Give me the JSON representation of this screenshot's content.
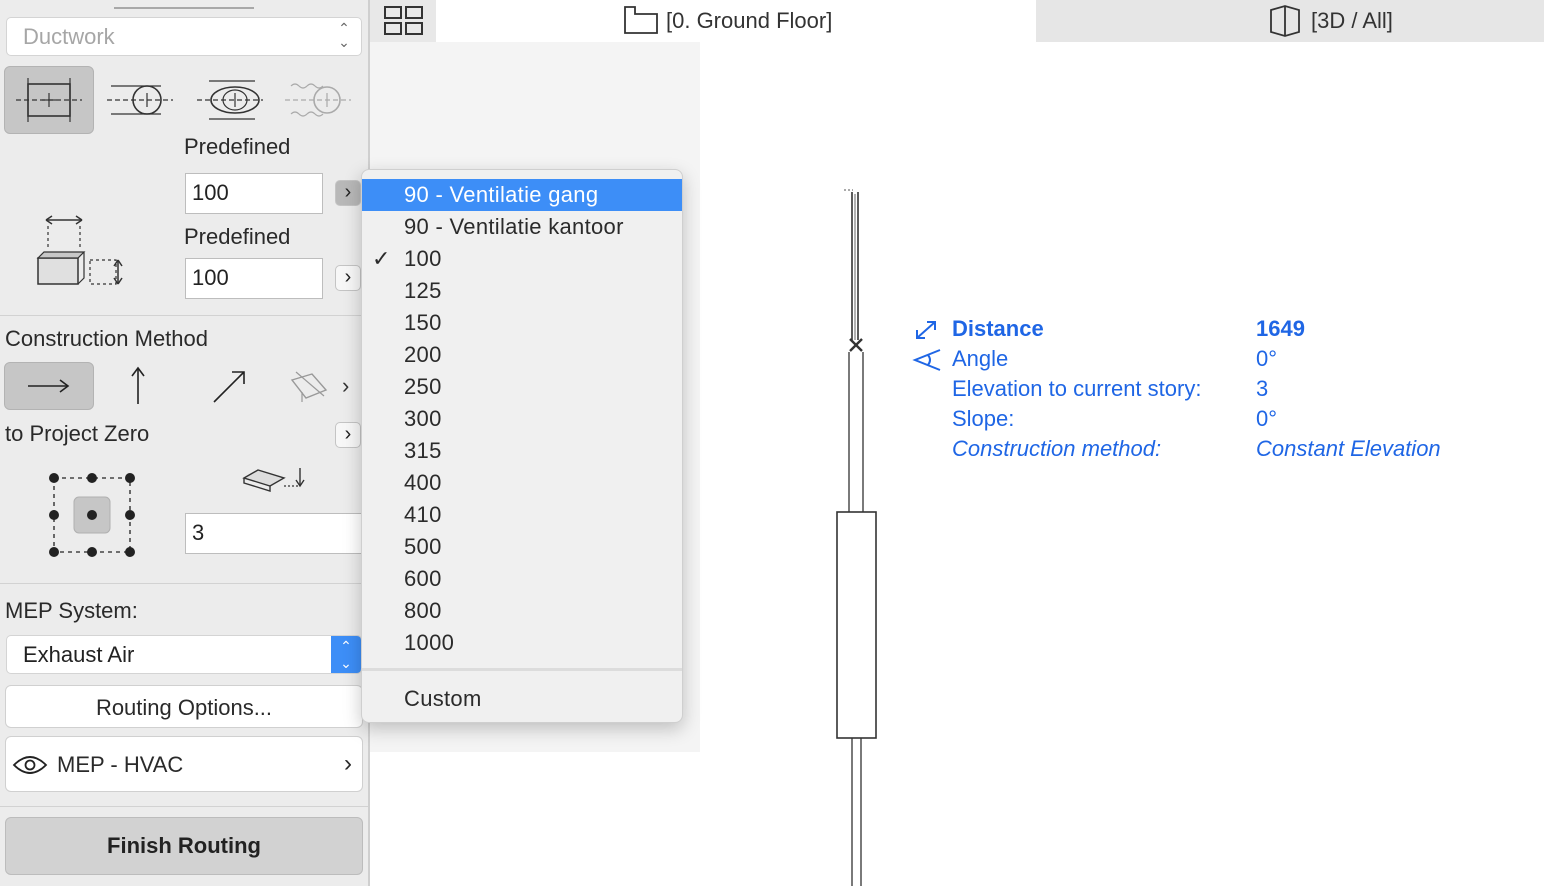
{
  "left_panel": {
    "tool_select": "Ductwork",
    "predefined_label_1": "Predefined",
    "width_value": "100",
    "predefined_label_2": "Predefined",
    "height_value": "100",
    "construction_method_label": "Construction Method",
    "reference_label": "to Project Zero",
    "elevation_value": "3",
    "mep_system_label": "MEP System:",
    "mep_system_value": "Exhaust Air",
    "routing_options_button": "Routing Options...",
    "layer_value": "MEP - HVAC",
    "finish_routing_button": "Finish Routing",
    "icons": {
      "shape_rectangular": "rectangular-duct-icon",
      "shape_circular": "circular-duct-icon",
      "shape_oval": "oval-duct-icon",
      "shape_flexible": "flexible-duct-icon",
      "dimensions": "duct-dimensions-icon",
      "method_horizontal": "arrow-right-icon",
      "method_vertical": "arrow-up-icon",
      "method_diagonal": "arrow-diagonal-icon",
      "method_slope": "slope-plane-icon",
      "anchor_grid": "anchor-point-grid-icon",
      "elevation": "elevation-icon",
      "layer_visibility": "eye-icon"
    }
  },
  "tabs": {
    "ground_floor": "[0. Ground Floor]",
    "three_d": "[3D / All]"
  },
  "dropdown": {
    "items": [
      "90 - Ventilatie gang",
      "90 - Ventilatie kantoor",
      "100",
      "125",
      "150",
      "200",
      "250",
      "300",
      "315",
      "400",
      "410",
      "500",
      "600",
      "800",
      "1000"
    ],
    "highlighted": "90 - Ventilatie gang",
    "checked": "100",
    "custom": "Custom"
  },
  "tracker": {
    "distance_label": "Distance",
    "distance_value": "1649",
    "angle_label": "Angle",
    "angle_value": "0°",
    "elevation_label": "Elevation to current story:",
    "elevation_value": "3",
    "slope_label": "Slope:",
    "slope_value": "0°",
    "construction_label": "Construction method:",
    "construction_value": "Constant Elevation"
  },
  "colors": {
    "accent_blue": "#1f66e5",
    "highlight_blue": "#3d8ef7",
    "panel_bg": "#ececec"
  }
}
